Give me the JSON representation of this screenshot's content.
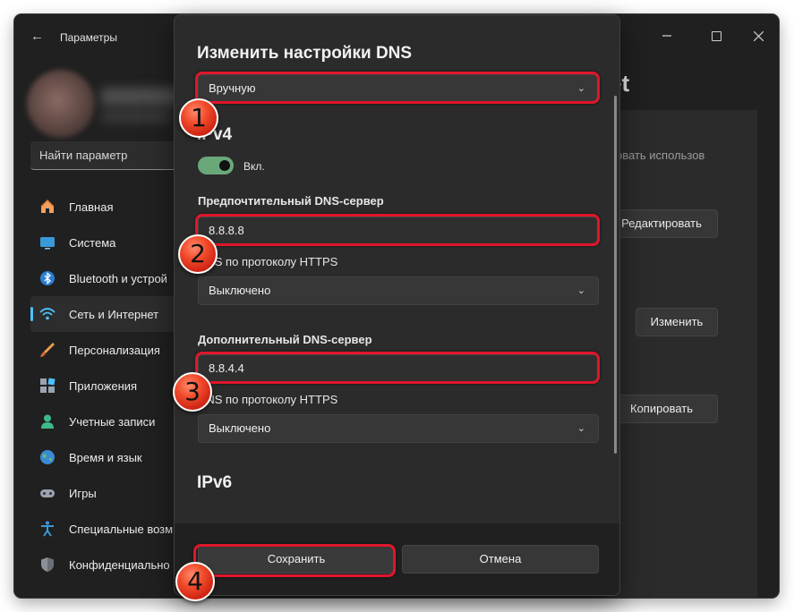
{
  "window": {
    "app_title": "Параметры",
    "search_placeholder": "Найти параметр"
  },
  "sidebar": {
    "items": [
      {
        "label": "Главная",
        "icon": "home-icon"
      },
      {
        "label": "Система",
        "icon": "system-icon"
      },
      {
        "label": "Bluetooth и устрой",
        "icon": "bluetooth-icon"
      },
      {
        "label": "Сеть и Интернет",
        "icon": "network-icon",
        "active": true
      },
      {
        "label": "Персонализация",
        "icon": "brush-icon"
      },
      {
        "label": "Приложения",
        "icon": "apps-icon"
      },
      {
        "label": "Учетные записи",
        "icon": "user-icon"
      },
      {
        "label": "Время и язык",
        "icon": "globe-icon"
      },
      {
        "label": "Игры",
        "icon": "gamepad-icon"
      },
      {
        "label": "Специальные возм",
        "icon": "accessibility-icon"
      },
      {
        "label": "Конфиденциально",
        "icon": "shield-icon"
      }
    ]
  },
  "background_page": {
    "heading_fragment": "et",
    "faded_text": "овать использов",
    "edit_button": "Редактировать",
    "change_button": "Изменить",
    "copy_button": "Копировать"
  },
  "dialog": {
    "title": "Изменить настройки DNS",
    "mode_select": "Вручную",
    "ipv4_title": "IPv4",
    "toggle_label": "Вкл.",
    "toggle_on": true,
    "preferred_label": "Предпочтительный DNS-сервер",
    "preferred_value": "8.8.8.8",
    "https_label_1": "DNS по протоколу HTTPS",
    "https_value_1": "Выключено",
    "alternate_label": "Дополнительный DNS-сервер",
    "alternate_value": "8.8.4.4",
    "https_label_2": "DNS по протоколу HTTPS",
    "https_value_2": "Выключено",
    "ipv6_title": "IPv6",
    "save_button": "Сохранить",
    "cancel_button": "Отмена"
  },
  "annotations": {
    "badge_1": "1",
    "badge_2": "2",
    "badge_3": "3",
    "badge_4": "4",
    "highlight_color": "#e0162b",
    "badge_color": "#e8391f"
  },
  "colors": {
    "accent": "#4cc2ff",
    "toggle_on": "#6aa87a"
  }
}
